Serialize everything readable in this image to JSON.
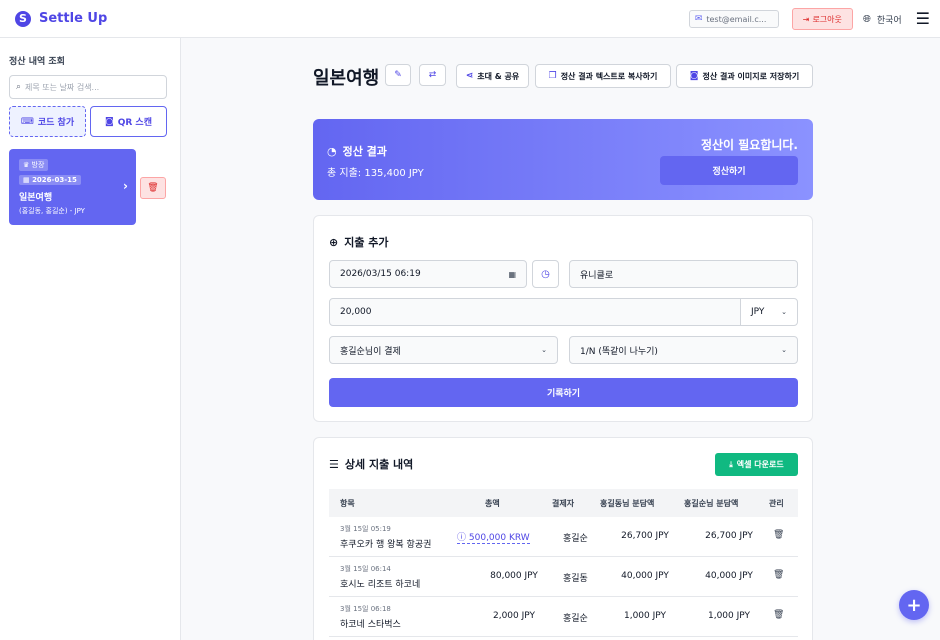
{
  "app": {
    "logo_letter": "S",
    "name": "Settle Up"
  },
  "header": {
    "email": "test@email.c...",
    "logout_label": "로그아웃",
    "language_label": "한국어"
  },
  "sidebar": {
    "title": "정산 내역 조회",
    "search_placeholder": "제목 또는 날짜 검색...",
    "join_code_label": "코드 참가",
    "qr_scan_label": "QR 스캔",
    "trip": {
      "role_badge": "방장",
      "date_badge": "2026-03-15",
      "name": "일본여행",
      "members_currency": "(홍길동, 홍길순) - JPY"
    }
  },
  "main": {
    "title": "일본여행",
    "toolbar": {
      "invite_share_label": "초대 & 공유",
      "copy_text_label": "정산 결과 텍스트로 복사하기",
      "save_image_label": "정산 결과 이미지로 저장하기"
    },
    "summary": {
      "title": "정산 결과",
      "total": "총 지출: 135,400 JPY",
      "status": "정산이 필요합니다.",
      "settle_button": "정산하기"
    },
    "add_expense": {
      "title": "지출 추가",
      "datetime_value": "2026/03/15 06:19",
      "item_value": "유니클로",
      "amount_value": "20,000",
      "currency_value": "JPY",
      "payer_value": "홍길순님이 결제",
      "split_value": "1/N (똑같이 나누기)",
      "submit_label": "기록하기"
    },
    "expense_list": {
      "title": "상세 지출 내역",
      "excel_label": "엑셀 다운로드",
      "columns": [
        "항목",
        "총액",
        "결제자",
        "홍길동님 분담액",
        "홍길순님 분담액",
        "관리"
      ],
      "rows": [
        {
          "date": "3월 15일 05:19",
          "item": "후쿠오카 행 왕복 항공권",
          "amount": "500,000 KRW",
          "payer": "홍길순",
          "share1": "26,700 JPY",
          "share2": "26,700 JPY"
        },
        {
          "date": "3월 15일 06:14",
          "item": "호시노 리조트 하코네",
          "amount": "80,000 JPY",
          "payer": "홍길동",
          "share1": "40,000 JPY",
          "share2": "40,000 JPY"
        },
        {
          "date": "3월 15일 06:18",
          "item": "하코네 스타벅스",
          "amount": "2,000 JPY",
          "payer": "홍길순",
          "share1": "1,000 JPY",
          "share2": "1,000 JPY"
        }
      ]
    },
    "fab_label": "+"
  },
  "colors": {
    "accent": "#6366f1",
    "danger": "#dc2626",
    "success": "#10b981"
  }
}
